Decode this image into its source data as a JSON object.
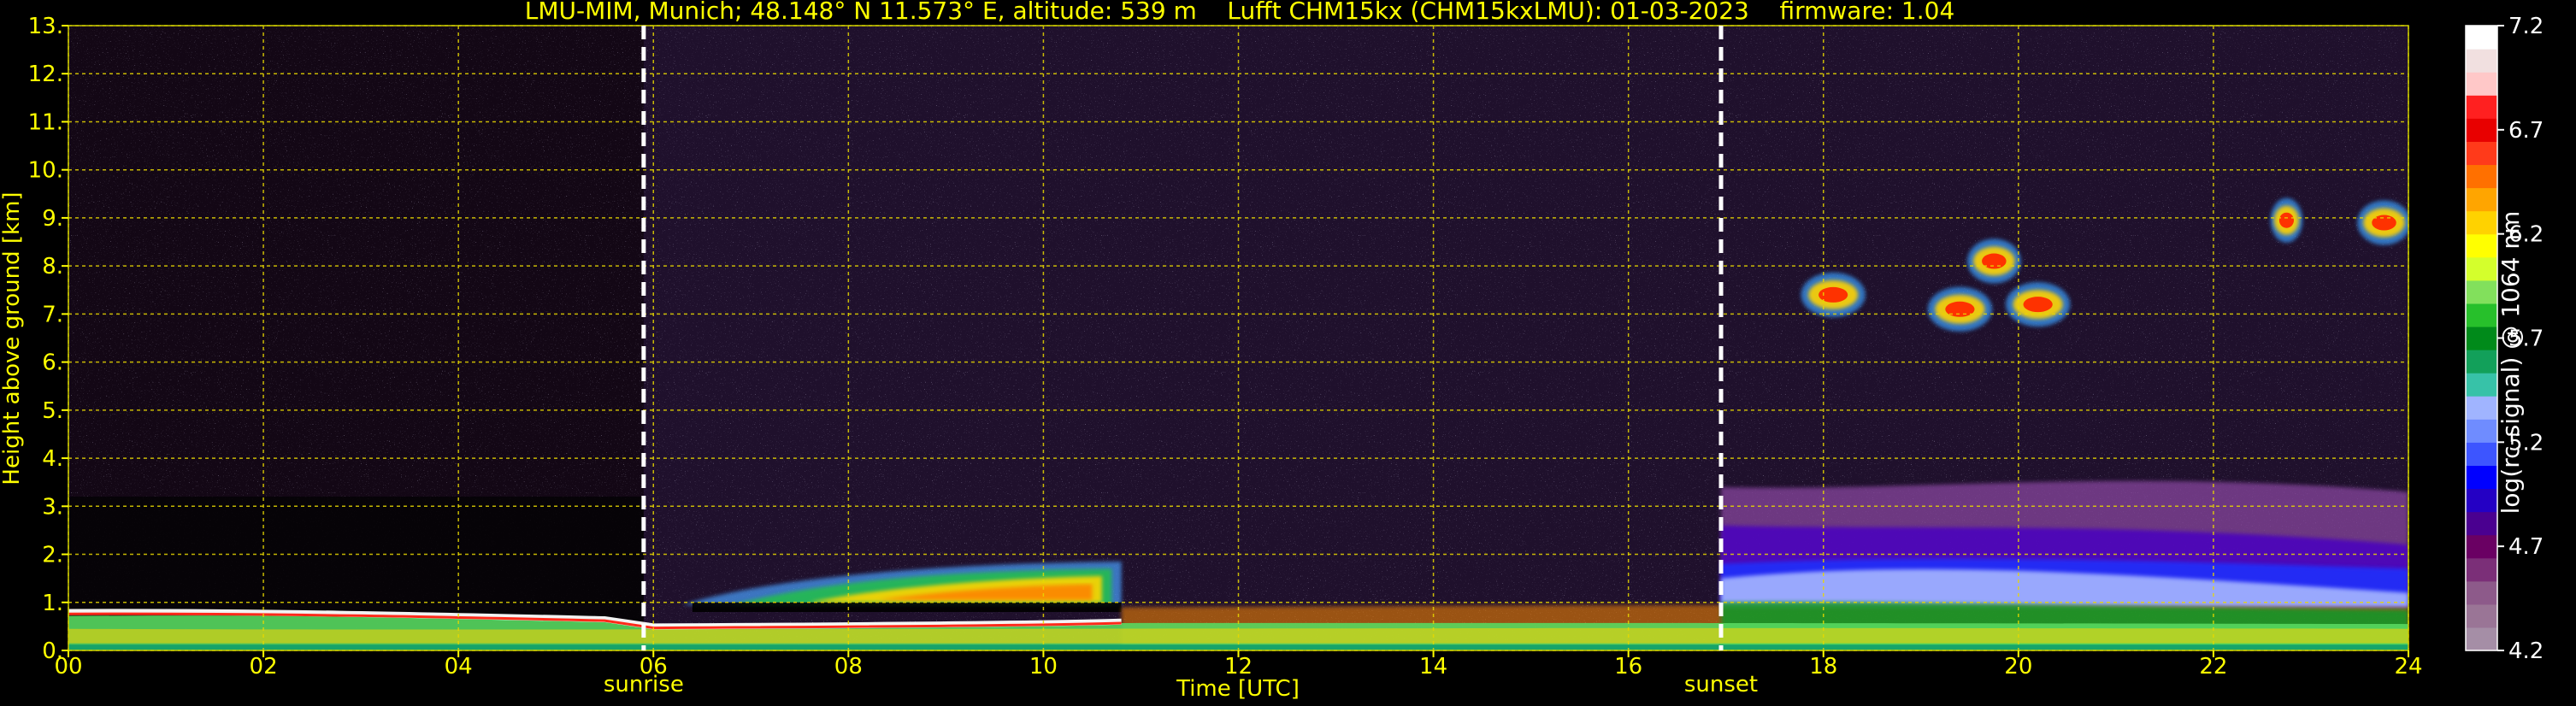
{
  "title": "LMU-MIM, Munich; 48.148° N 11.573° E, altitude: 539 m    Lufft CHM15kx (CHM15kxLMU): 01-03-2023    firmware: 1.04",
  "chart_data": {
    "type": "heatmap",
    "xlabel": "Time [UTC]",
    "ylabel": "Height above ground [km]",
    "xlim": [
      0,
      24
    ],
    "ylim": [
      0,
      13
    ],
    "x_ticks": [
      "00",
      "02",
      "04",
      "06",
      "08",
      "10",
      "12",
      "14",
      "16",
      "18",
      "20",
      "22",
      "24"
    ],
    "y_ticks": [
      "0.",
      "1.",
      "2.",
      "3.",
      "4.",
      "5.",
      "6.",
      "7.",
      "8.",
      "9.",
      "10.",
      "11.",
      "12.",
      "13."
    ],
    "grid": true,
    "events": [
      {
        "label": "sunrise",
        "time": 5.9
      },
      {
        "label": "sunset",
        "time": 16.95
      }
    ],
    "colorbar": {
      "label": "log(rc-signal) @ 1064 nm",
      "range": [
        4.2,
        7.2
      ],
      "ticks": [
        "4.2",
        "4.7",
        "5.2",
        "5.7",
        "6.2",
        "6.7",
        "7.2"
      ],
      "colors": [
        "#a58ea6",
        "#9a7596",
        "#8d5a8a",
        "#7b2f78",
        "#6a0063",
        "#4a0090",
        "#2400c4",
        "#0000ff",
        "#3d55ff",
        "#6f8cff",
        "#a0b4ff",
        "#37c2a8",
        "#12a05a",
        "#008a1a",
        "#27c02b",
        "#82e05c",
        "#d4ff2c",
        "#ffff00",
        "#ffd200",
        "#ffa500",
        "#ff7000",
        "#ff3a1a",
        "#e80000",
        "#ff2020",
        "#ffc8c8",
        "#f1e0e0",
        "#ffffff"
      ]
    },
    "features": [
      {
        "name": "night boundary layer",
        "t_start": 0,
        "t_end": 5.9,
        "h_top_km": 0.8
      },
      {
        "name": "convective boundary layer",
        "t_start": 6.3,
        "t_end": 10.8,
        "h_top_km": 1.8
      },
      {
        "name": "daytime mixed layer",
        "t_start": 10.8,
        "t_end": 24,
        "h_top_km": 1.0
      },
      {
        "name": "evening residual layer",
        "t_start": 16.95,
        "t_end": 24,
        "h_top_km": 3.5
      },
      {
        "name": "cirrus cloud",
        "t_start": 17.8,
        "t_end": 18.4,
        "h_km": 7.4
      },
      {
        "name": "cirrus cloud",
        "t_start": 19.1,
        "t_end": 19.7,
        "h_km": 7.1
      },
      {
        "name": "cirrus cloud",
        "t_start": 19.5,
        "t_end": 20.0,
        "h_km": 8.1
      },
      {
        "name": "cirrus cloud",
        "t_start": 19.9,
        "t_end": 20.5,
        "h_km": 7.2
      },
      {
        "name": "cirrus cloud",
        "t_start": 22.6,
        "t_end": 22.9,
        "h_km": 8.95
      },
      {
        "name": "cirrus cloud",
        "t_start": 23.5,
        "t_end": 24,
        "h_km": 8.9
      }
    ]
  }
}
